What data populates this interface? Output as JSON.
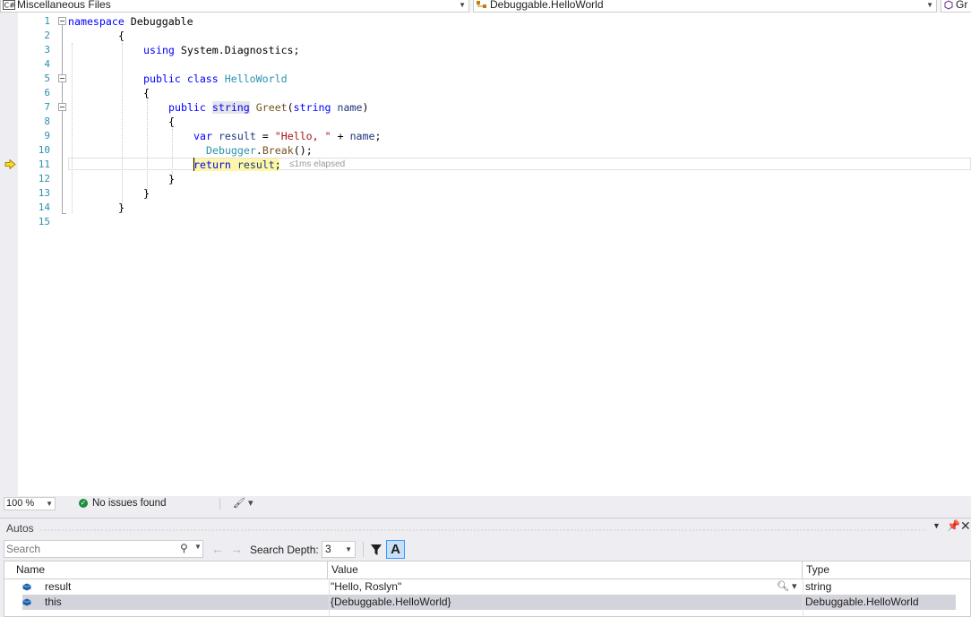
{
  "navbar": {
    "project": "Miscellaneous Files",
    "type": "Debuggable.HelloWorld",
    "member": "Gr"
  },
  "editor": {
    "line_numbers": [
      "1",
      "2",
      "3",
      "4",
      "5",
      "6",
      "7",
      "8",
      "9",
      "10",
      "11",
      "12",
      "13",
      "14",
      "15"
    ],
    "code": {
      "l1_kw": "namespace",
      "l1_name": " Debuggable",
      "l2": "{",
      "l3_kw": "using",
      "l3_rest": " System.Diagnostics;",
      "l5_kw": "public class",
      "l5_type": "HelloWorld",
      "l6": "{",
      "l7_kw1": "public",
      "l7_kw2": "string",
      "l7_method": "Greet",
      "l7_open": "(",
      "l7_kw3": "string",
      "l7_param": "name",
      "l7_close": ")",
      "l8": "{",
      "l9_kw": "var",
      "l9_var": "result",
      "l9_eq": " = ",
      "l9_str": "\"Hello, \"",
      "l9_plus": " + ",
      "l9_param": "name",
      "l9_end": ";",
      "l10_type": "Debugger",
      "l10_dot": ".",
      "l10_method": "Break",
      "l10_end": "();",
      "l11_kw": "return",
      "l11_var": "result",
      "l11_end": ";",
      "l12": "}",
      "l13": "}",
      "l14": "}"
    },
    "elapsed_hint": "≤1ms elapsed"
  },
  "status_bar": {
    "zoom": "100 %",
    "issues": "No issues found"
  },
  "autos": {
    "title": "Autos",
    "search_placeholder": "Search",
    "search_depth_label": "Search Depth:",
    "search_depth_value": "3",
    "font_button": "A",
    "columns": {
      "name": "Name",
      "value": "Value",
      "type": "Type"
    },
    "rows": [
      {
        "name": "result",
        "value": "\"Hello, Roslyn\"",
        "type": "string"
      },
      {
        "name": "this",
        "value": "{Debuggable.HelloWorld}",
        "type": "Debuggable.HelloWorld"
      }
    ]
  },
  "colors": {
    "keyword": "#0000ff",
    "type": "#2b91af",
    "string": "#a31515",
    "execution_highlight": "#fef7a7",
    "selected_row": "#d3d3dc"
  },
  "icons": {
    "project": "csharp-file-icon",
    "type": "class-icon",
    "member": "method-icon",
    "execution_pointer": "current-statement-arrow-icon",
    "field": "field-icon"
  }
}
